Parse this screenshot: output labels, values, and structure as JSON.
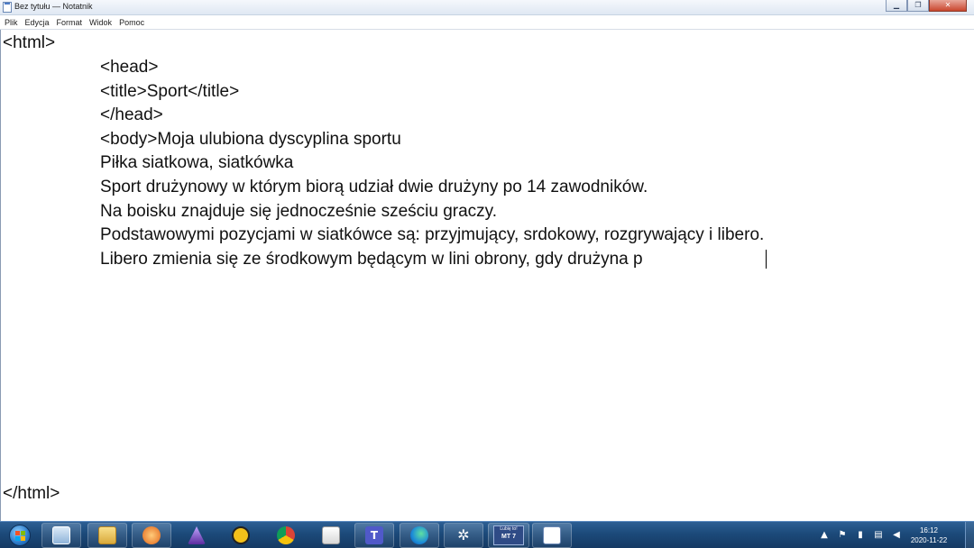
{
  "window": {
    "title": "Bez tytułu — Notatnik",
    "minimize_glyph": "▁",
    "maximize_glyph": "❐",
    "close_glyph": "✕"
  },
  "menu": {
    "items": [
      "Plik",
      "Edycja",
      "Format",
      "Widok",
      "Pomoc"
    ]
  },
  "editor": {
    "lines": [
      "<html>",
      "<head>",
      "<title>Sport</title>",
      "</head>",
      "<body>Moja ulubiona dyscyplina sportu",
      "Piłka siatkowa, siatkówka",
      "Sport drużynowy w którym biorą udział dwie drużyny po 14 zawodników.",
      "Na boisku znajduje się jednocześnie sześciu graczy.",
      "Podstawowymi pozycjami w siatkówce są: przyjmujący, srdokowy, rozgrywający i libero.",
      "Libero zmienia się ze środkowym będącym w lini obrony, gdy drużyna p",
      "</html>"
    ]
  },
  "taskbar": {
    "apps": [
      {
        "name": "start",
        "icon": "windows-logo-icon"
      },
      {
        "name": "window",
        "icon": "window-icon"
      },
      {
        "name": "explorer",
        "icon": "folder-icon"
      },
      {
        "name": "media",
        "icon": "media-player-icon"
      },
      {
        "name": "wizard",
        "icon": "wizard-icon"
      },
      {
        "name": "triangle",
        "icon": "triangle-logo-icon"
      },
      {
        "name": "chrome",
        "icon": "chrome-icon"
      },
      {
        "name": "paint",
        "icon": "paint-icon"
      },
      {
        "name": "teams",
        "icon": "teams-icon"
      },
      {
        "name": "edge",
        "icon": "edge-icon"
      },
      {
        "name": "snowflake",
        "icon": "snowflake-icon"
      },
      {
        "name": "mt7",
        "icon": "mt7-app-icon",
        "label_top": "Lubię to!",
        "label": "MT 7"
      },
      {
        "name": "notepad",
        "icon": "notepad-icon"
      }
    ],
    "tray": {
      "time": "16:12",
      "date": "2020-11-22"
    }
  }
}
